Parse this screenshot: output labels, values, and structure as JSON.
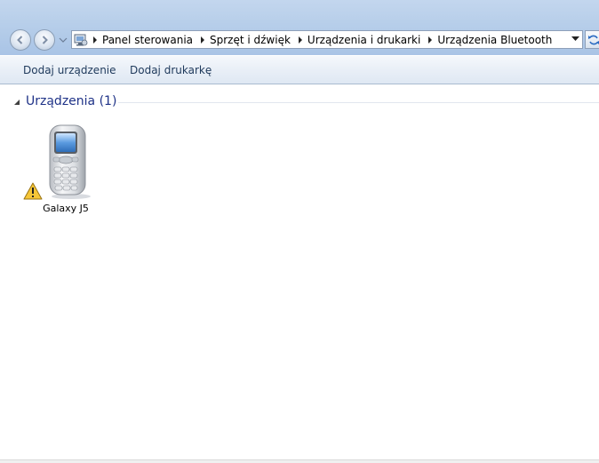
{
  "address_bar": {
    "breadcrumbs": [
      {
        "label": "Panel sterowania"
      },
      {
        "label": "Sprzęt i dźwięk"
      },
      {
        "label": "Urządzenia i drukarki"
      },
      {
        "label": "Urządzenia Bluetooth"
      }
    ],
    "location_icon": "control-panel-icon"
  },
  "command_bar": {
    "add_device_label": "Dodaj urządzenie",
    "add_printer_label": "Dodaj drukarkę"
  },
  "group": {
    "title": "Urządzenia (1)",
    "expanded": true
  },
  "devices": [
    {
      "name": "Galaxy J5",
      "icon": "mobile-phone-icon",
      "status_icon": "warning-icon"
    }
  ],
  "colors": {
    "accent_text": "#1e3287",
    "command_text": "#1e395b",
    "nav_background": "#b8cfea"
  }
}
